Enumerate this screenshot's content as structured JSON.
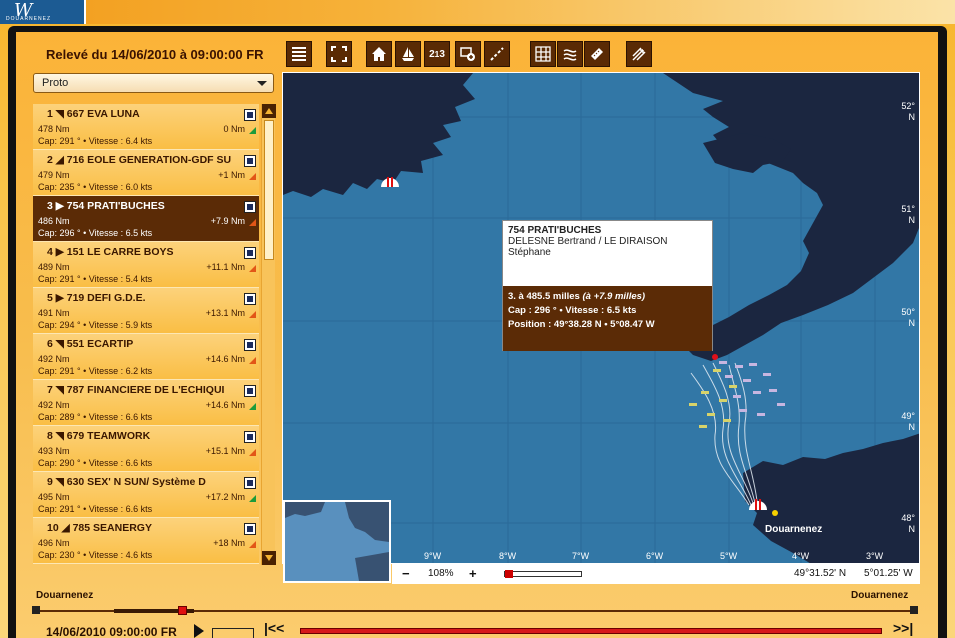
{
  "header": {
    "title": "Relevé du 14/06/2010 à 09:00:00 FR"
  },
  "toolbar": {
    "buttons": [
      {
        "name": "list-icon"
      },
      {
        "name": "fullscreen-icon"
      },
      {
        "name": "home-icon"
      },
      {
        "name": "sailboat-icon"
      },
      {
        "name": "ranking-icon",
        "glyph": "2¹13"
      },
      {
        "name": "zoom-in-icon"
      },
      {
        "name": "route-icon"
      },
      {
        "name": "grid-icon"
      },
      {
        "name": "wind-icon"
      },
      {
        "name": "ruler-icon"
      },
      {
        "name": "wind-arrows-icon"
      }
    ]
  },
  "category_select": {
    "value": "Proto"
  },
  "boats": [
    {
      "line1": "1 ◥ 667 EVA LUNA",
      "dist": "478 Nm",
      "gap": "0 Nm",
      "cap": "Cap: 291 ° • Vitesse : 6.4 kts",
      "trend": "up",
      "selected": false
    },
    {
      "line1": "2 ◢ 716 EOLE GENERATION-GDF SU",
      "dist": "479 Nm",
      "gap": "+1 Nm",
      "cap": "Cap: 235 ° • Vitesse : 6.0 kts",
      "trend": "down",
      "selected": false
    },
    {
      "line1": "3 ▶ 754 PRATI'BUCHES",
      "dist": "486 Nm",
      "gap": "+7.9 Nm",
      "cap": "Cap: 296 ° • Vitesse : 6.5 kts",
      "trend": "down",
      "selected": true
    },
    {
      "line1": "4 ▶ 151 LE CARRE BOYS",
      "dist": "489 Nm",
      "gap": "+11.1 Nm",
      "cap": "Cap: 291 ° • Vitesse : 5.4 kts",
      "trend": "down",
      "selected": false
    },
    {
      "line1": "5 ▶ 719 DEFI G.D.E.",
      "dist": "491 Nm",
      "gap": "+13.1 Nm",
      "cap": "Cap: 294 ° • Vitesse : 5.9 kts",
      "trend": "down",
      "selected": false
    },
    {
      "line1": "6 ◥ 551 ECARTIP",
      "dist": "492 Nm",
      "gap": "+14.6 Nm",
      "cap": "Cap: 291 ° • Vitesse : 6.2 kts",
      "trend": "down",
      "selected": false
    },
    {
      "line1": "7 ◥ 787 FINANCIERE DE L'ECHIQUI",
      "dist": "492 Nm",
      "gap": "+14.6 Nm",
      "cap": "Cap: 289 ° • Vitesse : 6.6 kts",
      "trend": "up",
      "selected": false
    },
    {
      "line1": "8 ◥ 679 TEAMWORK",
      "dist": "493 Nm",
      "gap": "+15.1 Nm",
      "cap": "Cap: 290 ° • Vitesse : 6.6 kts",
      "trend": "down",
      "selected": false
    },
    {
      "line1": "9 ◥ 630 SEX' N SUN/ Système D",
      "dist": "495 Nm",
      "gap": "+17.2 Nm",
      "cap": "Cap: 291 ° • Vitesse : 6.6 kts",
      "trend": "up",
      "selected": false
    },
    {
      "line1": "10 ◢ 785 SEANERGY",
      "dist": "496 Nm",
      "gap": "+18 Nm",
      "cap": "Cap: 230 ° • Vitesse : 4.6 kts",
      "trend": "down",
      "selected": false
    }
  ],
  "popup": {
    "name": "754 PRATI'BUCHES",
    "crew": "DELESNE Bertrand / LE DIRAISON Stéphane",
    "rank_line": "3. à 485.5 milles",
    "rank_extra": "(à +7.9 milles)",
    "cap_line": "Cap : 296 ° • Vitesse : 6.5 kts",
    "position_line": "Position : 49°38.28 N • 5°08.47 W"
  },
  "map": {
    "lat_labels": [
      {
        "deg": "52°",
        "hem": "N"
      },
      {
        "deg": "51°",
        "hem": "N"
      },
      {
        "deg": "50°",
        "hem": "N"
      },
      {
        "deg": "49°",
        "hem": "N"
      },
      {
        "deg": "48°",
        "hem": "N"
      }
    ],
    "lon_labels": [
      "9°W",
      "8°W",
      "7°W",
      "6°W",
      "5°W",
      "4°W",
      "3°W"
    ],
    "place": "Douarnenez",
    "zoom_level": "108%",
    "zoom_minus": "−",
    "zoom_plus": "+",
    "coord_lat": "49°31.52' N",
    "coord_lon": "5°01.25' W"
  },
  "timeline": {
    "start_label": "Douarnenez",
    "end_label": "Douarnenez",
    "date": "14/06/2010 09:00:00 FR"
  },
  "colors": {
    "panel_orange": "#fbb338",
    "selected_brown": "#5b2b06",
    "sea": "#3277a6",
    "land": "#1b2640",
    "trend_up": "#1d9b3b",
    "trend_down": "#e25617"
  }
}
